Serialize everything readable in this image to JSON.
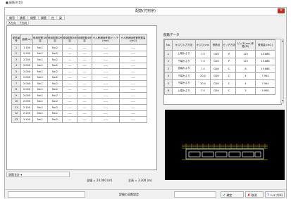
{
  "page": {
    "crumb": "■ 配筋(付判)"
  },
  "window": {
    "title": "配筋(付判序)",
    "close_glyph": "✕"
  },
  "menu": {
    "items": [
      {
        "label": "開窓"
      },
      {
        "label": "鉄筋"
      },
      {
        "label": "側壁"
      },
      {
        "label": "隔壁"
      },
      {
        "label": "柱"
      },
      {
        "label": "梁"
      }
    ]
  },
  "subtabs": [
    {
      "label": "X方向"
    },
    {
      "label": "Y方向"
    }
  ],
  "left_table": {
    "headers": [
      "配筋番号",
      "面積(m)",
      "使用配筋1段目",
      "使用配筋2段目",
      "使用配筋3段目",
      "使用配筋4段目",
      "せん断補強鉄筋(ピッチ(mm)",
      "せん断補強鉄筋鉄筋量(cm2)"
    ],
    "rows": [
      [
        "1",
        "1.100",
        "No.1",
        "No.2",
        "----",
        "----",
        "-----",
        "-----"
      ],
      [
        "2",
        "2.200",
        "No.1",
        "No.2",
        "----",
        "----",
        "-----",
        "-----"
      ],
      [
        "3",
        "2.200",
        "No.1",
        "No.2",
        "----",
        "----",
        "-----",
        "-----"
      ],
      [
        "4",
        "2.000",
        "No.1",
        "No.2",
        "----",
        "----",
        "-----",
        "-----"
      ],
      [
        "5",
        "2.000",
        "No.1",
        "No.2",
        "----",
        "----",
        "-----",
        "-----"
      ],
      [
        "6",
        "2.000",
        "No.1",
        "No.2",
        "----",
        "----",
        "-----",
        "-----"
      ],
      [
        "7",
        "2.000",
        "No.1",
        "No.2",
        "----",
        "----",
        "-----",
        "-----"
      ],
      [
        "8",
        "2.000",
        "No.1",
        "No.2",
        "----",
        "----",
        "-----",
        "-----"
      ],
      [
        "9",
        "2.000",
        "No.1",
        "No.2",
        "----",
        "----",
        "-----",
        "-----"
      ],
      [
        "10",
        "2.000",
        "No.1",
        "No.2",
        "----",
        "----",
        "-----",
        "-----"
      ],
      [
        "11",
        "2.100",
        "No.1",
        "No.2",
        "----",
        "----",
        "-----",
        "-----"
      ],
      [
        "12",
        "2.200",
        "No.1",
        "No.2",
        "----",
        "----",
        "-----",
        "-----"
      ],
      [
        "13",
        "1.100",
        "No.1",
        "No.2",
        "----",
        "----",
        "-----",
        "-----"
      ]
    ]
  },
  "total": {
    "label": "鉄筋全計 ▾"
  },
  "footer_notes": {
    "width": "全幅 = 24.000 (m)",
    "full": "全高 = 3.300 (m)"
  },
  "right": {
    "label": "配筋データ",
    "headers": [
      "No.",
      "かぶり入力方法",
      "かぶり(cm)",
      "鉄筋径",
      "ピッチ方法",
      "ピッチ(mm)本数(本)",
      "鉄筋量(cm2)"
    ],
    "rows": [
      [
        "1",
        "上端かぶり",
        "7.0",
        "D16",
        "P",
        "125",
        "15.888"
      ],
      [
        "2",
        "下端かぶり",
        "7.0",
        "D16",
        "P",
        "125",
        "15.888"
      ],
      [
        "3",
        "全幅かぶり",
        "7.0",
        "D16",
        "C",
        "8",
        "15.888"
      ],
      [
        "4",
        "下端かぶり",
        "20.0",
        "D16",
        "C",
        "4",
        "7.944"
      ],
      [
        "5",
        "下端かぶり",
        "10.0",
        "D16",
        "C",
        "4",
        "7.944"
      ],
      [
        "6",
        "上端かぶり",
        "7.0",
        "D16",
        "C",
        "3",
        "5.958"
      ]
    ]
  },
  "status": {
    "text": "詳細の全数設定"
  },
  "buttons": {
    "ok": "確定",
    "cancel": "取消",
    "help": "ヘルプ(H)"
  }
}
